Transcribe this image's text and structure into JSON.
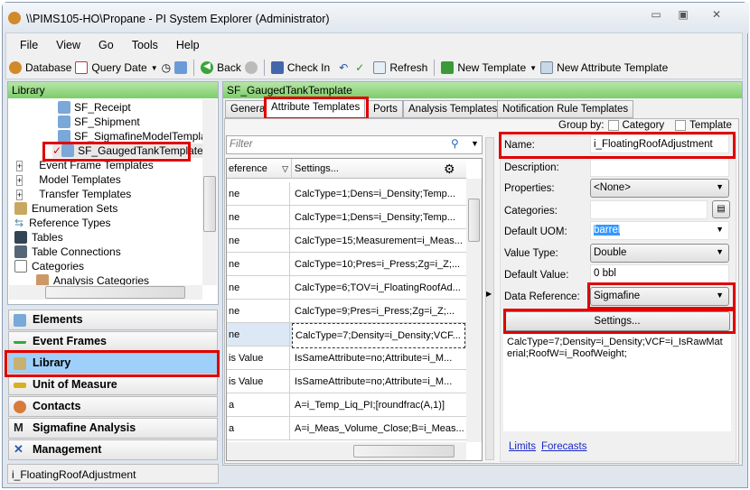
{
  "window": {
    "title": "\\\\PIMS105-HO\\Propane - PI System Explorer (Administrator)"
  },
  "menu": [
    "File",
    "View",
    "Go",
    "Tools",
    "Help"
  ],
  "toolbar": {
    "database": "Database",
    "query_date": "Query Date",
    "back": "Back",
    "check_in": "Check In",
    "refresh": "Refresh",
    "new_template": "New Template",
    "new_attribute_template": "New Attribute Template"
  },
  "left": {
    "header": "Library",
    "tree": [
      "SF_Receipt",
      "SF_Shipment",
      "SF_SigmafineModelTemplate",
      "SF_GaugedTankTemplate",
      "Event Frame Templates",
      "Model Templates",
      "Transfer Templates",
      "Enumeration Sets",
      "Reference Types",
      "Tables",
      "Table Connections",
      "Categories",
      "Analysis Categories"
    ],
    "nav": [
      "Elements",
      "Event Frames",
      "Library",
      "Unit of Measure",
      "Contacts",
      "Sigmafine Analysis",
      "Management"
    ],
    "status": "i_FloatingRoofAdjustment"
  },
  "main": {
    "header": "SF_GaugedTankTemplate",
    "tabs": [
      "General",
      "Attribute Templates",
      "Ports",
      "Analysis Templates",
      "Notification Rule Templates"
    ],
    "group_by": {
      "label": "Group by:",
      "category": "Category",
      "template": "Template"
    },
    "filter_placeholder": "Filter",
    "grid": {
      "columns": [
        "eference",
        "Settings..."
      ],
      "rows": [
        [
          "ne",
          "CalcType=1;Dens=i_Density;Temp..."
        ],
        [
          "ne",
          "CalcType=1;Dens=i_Density;Temp..."
        ],
        [
          "ne",
          "CalcType=15;Measurement=i_Meas..."
        ],
        [
          "ne",
          "CalcType=10;Pres=i_Press;Zg=i_Z;..."
        ],
        [
          "ne",
          "CalcType=6;TOV=i_FloatingRoofAd..."
        ],
        [
          "ne",
          "CalcType=9;Pres=i_Press;Zg=i_Z;..."
        ],
        [
          "ne",
          "CalcType=7;Density=i_Density;VCF..."
        ],
        [
          "is Value",
          "IsSameAttribute=no;Attribute=i_M..."
        ],
        [
          "is Value",
          "IsSameAttribute=no;Attribute=i_M..."
        ],
        [
          "a",
          "A=i_Temp_Liq_PI;[roundfrac(A,1)]"
        ],
        [
          "a",
          "A=i_Meas_Volume_Close;B=i_Meas..."
        ]
      ]
    },
    "details": {
      "name_label": "Name:",
      "name": "i_FloatingRoofAdjustment",
      "description_label": "Description:",
      "description": "",
      "properties_label": "Properties:",
      "properties": "<None>",
      "categories_label": "Categories:",
      "default_uom_label": "Default UOM:",
      "default_uom": "barrel",
      "value_type_label": "Value Type:",
      "value_type": "Double",
      "default_value_label": "Default Value:",
      "default_value": "0 bbl",
      "data_reference_label": "Data Reference:",
      "data_reference": "Sigmafine",
      "settings_button": "Settings...",
      "config_string": "CalcType=7;Density=i_Density;VCF=i_IsRawMaterial;RoofW=i_RoofWeight;",
      "links": [
        "Limits",
        "Forecasts"
      ]
    }
  }
}
